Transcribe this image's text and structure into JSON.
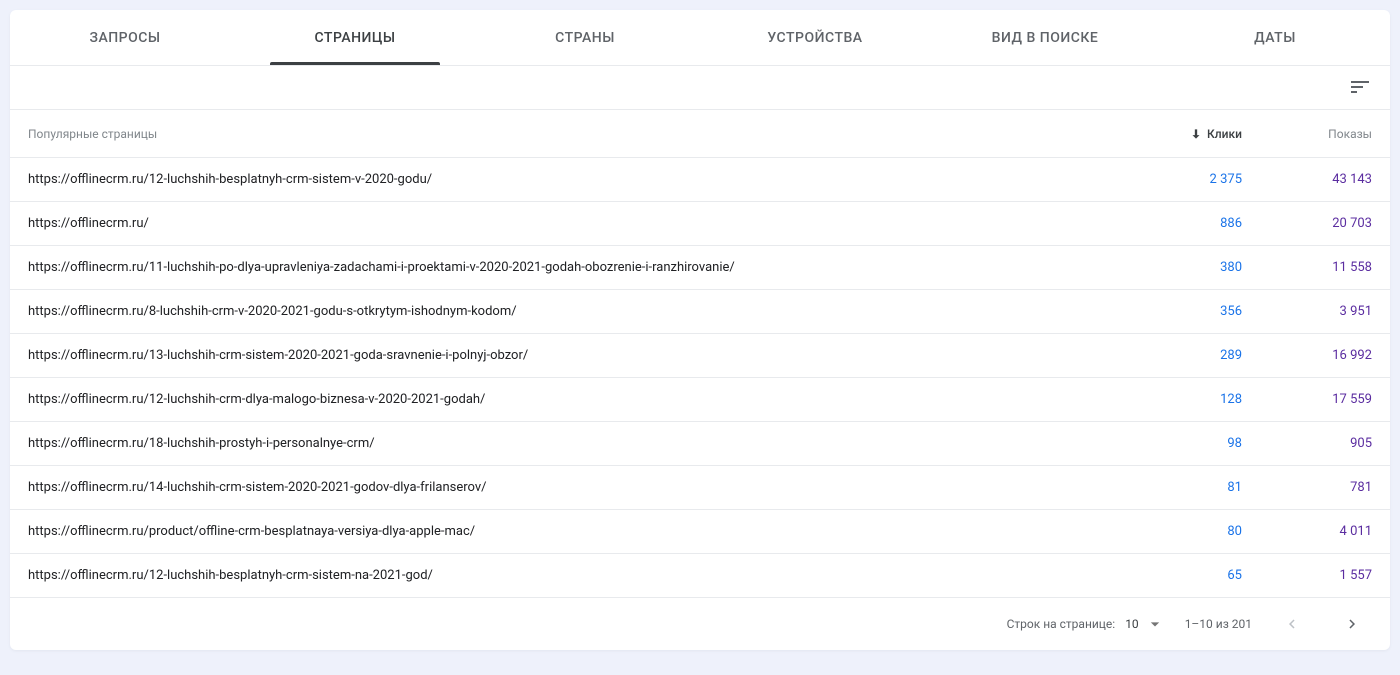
{
  "tabs": {
    "queries": "ЗАПРОСЫ",
    "pages": "СТРАНИЦЫ",
    "countries": "СТРАНЫ",
    "devices": "УСТРОЙСТВА",
    "search_appearance": "ВИД В ПОИСКЕ",
    "dates": "ДАТЫ"
  },
  "table": {
    "header_page": "Популярные страницы",
    "header_clicks": "Клики",
    "header_impressions": "Показы",
    "rows": [
      {
        "url": "https://offlinecrm.ru/12-luchshih-besplatnyh-crm-sistem-v-2020-godu/",
        "clicks": "2 375",
        "impressions": "43 143"
      },
      {
        "url": "https://offlinecrm.ru/",
        "clicks": "886",
        "impressions": "20 703"
      },
      {
        "url": "https://offlinecrm.ru/11-luchshih-po-dlya-upravleniya-zadachami-i-proektami-v-2020-2021-godah-obozrenie-i-ranzhirovanie/",
        "clicks": "380",
        "impressions": "11 558"
      },
      {
        "url": "https://offlinecrm.ru/8-luchshih-crm-v-2020-2021-godu-s-otkrytym-ishodnym-kodom/",
        "clicks": "356",
        "impressions": "3 951"
      },
      {
        "url": "https://offlinecrm.ru/13-luchshih-crm-sistem-2020-2021-goda-sravnenie-i-polnyj-obzor/",
        "clicks": "289",
        "impressions": "16 992"
      },
      {
        "url": "https://offlinecrm.ru/12-luchshih-crm-dlya-malogo-biznesa-v-2020-2021-godah/",
        "clicks": "128",
        "impressions": "17 559"
      },
      {
        "url": "https://offlinecrm.ru/18-luchshih-prostyh-i-personalnye-crm/",
        "clicks": "98",
        "impressions": "905"
      },
      {
        "url": "https://offlinecrm.ru/14-luchshih-crm-sistem-2020-2021-godov-dlya-frilanserov/",
        "clicks": "81",
        "impressions": "781"
      },
      {
        "url": "https://offlinecrm.ru/product/offline-crm-besplatnaya-versiya-dlya-apple-mac/",
        "clicks": "80",
        "impressions": "4 011"
      },
      {
        "url": "https://offlinecrm.ru/12-luchshih-besplatnyh-crm-sistem-na-2021-god/",
        "clicks": "65",
        "impressions": "1 557"
      }
    ]
  },
  "pagination": {
    "rows_label": "Строк на странице:",
    "rows_value": "10",
    "range": "1–10 из 201"
  }
}
